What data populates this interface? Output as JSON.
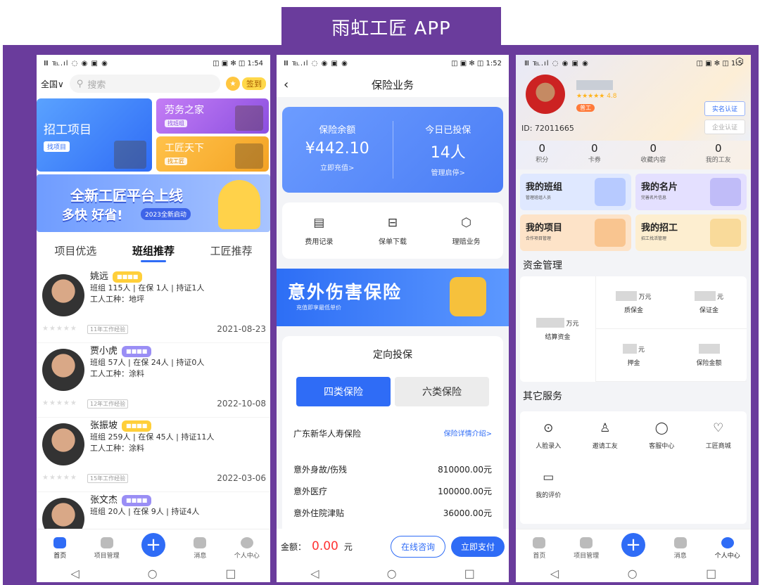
{
  "title": "雨虹工匠 APP",
  "s1": {
    "status": {
      "left": "Ⅲ ℡.ıl ◌ ◉ ▣ ◉",
      "right": "◫ ▣ ✻ ◫ 1:54"
    },
    "region": "全国∨",
    "search_placeholder": "搜索",
    "signin": "签到",
    "card_main": {
      "title": "招工项目",
      "button": "找项目"
    },
    "card_labor": {
      "title": "劳务之家",
      "button": "找班组"
    },
    "card_craft": {
      "title": "工匠天下",
      "button": "找工匠"
    },
    "banner": {
      "line1": "全新工匠平台上线",
      "line2": "多快 好省!",
      "pill": "2023全新启动"
    },
    "tabs": [
      "项目优选",
      "班组推荐",
      "工匠推荐"
    ],
    "people": [
      {
        "name": "姚远",
        "line1": "班组 115人 | 在保 1人 | 持证1人",
        "line2": "工人工种：地坪",
        "exp": "11年工作经验",
        "date": "2021-08-23"
      },
      {
        "name": "贾小虎",
        "line1": "班组 57人 | 在保 24人 | 持证0人",
        "line2": "工人工种：涂料",
        "exp": "12年工作经验",
        "date": "2022-10-08"
      },
      {
        "name": "张振坡",
        "line1": "班组 259人 | 在保 45人 | 持证11人",
        "line2": "工人工种：涂料",
        "exp": "15年工作经验",
        "date": "2022-03-06"
      },
      {
        "name": "张文杰",
        "line1": "班组 20人 | 在保 9人 | 持证4人",
        "line2": "",
        "exp": "",
        "date": ""
      }
    ],
    "tabbar": [
      "首页",
      "项目管理",
      "",
      "消息",
      "个人中心"
    ]
  },
  "s2": {
    "status": {
      "left": "Ⅲ ℡.ıl ◌ ◉ ▣ ◉",
      "right": "◫ ▣ ✻ ◫ 1:52"
    },
    "title": "保险业务",
    "balance_label": "保险余额",
    "balance_value": "¥442.10",
    "balance_link": "立即充值>",
    "today_label": "今日已投保",
    "today_value": "14人",
    "today_link": "管理启停>",
    "quick": [
      "费用记录",
      "保单下载",
      "理赔业务"
    ],
    "banner": {
      "title": "意外伤害保险",
      "sub": "充值即享最低单价"
    },
    "section": "定向投保",
    "btn_a": "四类保险",
    "btn_b": "六类保险",
    "insurer": "广东新华人寿保险",
    "insurer_link": "保险详情介绍>",
    "coverage": [
      {
        "item": "意外身故/伤残",
        "amount": "810000.00元"
      },
      {
        "item": "意外医疗",
        "amount": "100000.00元"
      },
      {
        "item": "意外住院津贴",
        "amount": "36000.00元"
      }
    ],
    "amount_label": "金额：",
    "amount_value": "0.00",
    "amount_unit": "元",
    "consult": "在线咨询",
    "pay": "立即支付"
  },
  "s3": {
    "status": {
      "left": "Ⅲ ℡.ıl ◌ ◉ ▣ ◉",
      "right": "◫ ▣ ✻ ◫ 1:5"
    },
    "stars": "★★★★★ 4.8",
    "badge": "普工",
    "id": "ID: 72011665",
    "realname": "实名认证",
    "enterprise": "企业认证",
    "stats": [
      {
        "value": "0",
        "label": "积分"
      },
      {
        "value": "0",
        "label": "卡券"
      },
      {
        "value": "0",
        "label": "收藏内容"
      },
      {
        "value": "0",
        "label": "我的工友"
      }
    ],
    "cards": [
      {
        "title": "我的班组",
        "sub": "管理班组人员"
      },
      {
        "title": "我的名片",
        "sub": "完善名片信息"
      },
      {
        "title": "我的项目",
        "sub": "合作项目管理"
      },
      {
        "title": "我的招工",
        "sub": "招工找活管理"
      }
    ],
    "fund_title": "资金管理",
    "fund": {
      "settle": "结算资金",
      "settle_unit": "万元",
      "quality": "质保金",
      "quality_unit": "万元",
      "deposit_guarantee": "保证金",
      "deposit_unit": "元",
      "pledge": "押金",
      "pledge_unit": "元",
      "insured": "保险金额"
    },
    "svc_title": "其它服务",
    "services": [
      "人脸录入",
      "邀请工友",
      "客服中心",
      "工匠商城",
      "我的评价"
    ],
    "tabbar": [
      "首页",
      "项目管理",
      "",
      "消息",
      "个人中心"
    ]
  }
}
